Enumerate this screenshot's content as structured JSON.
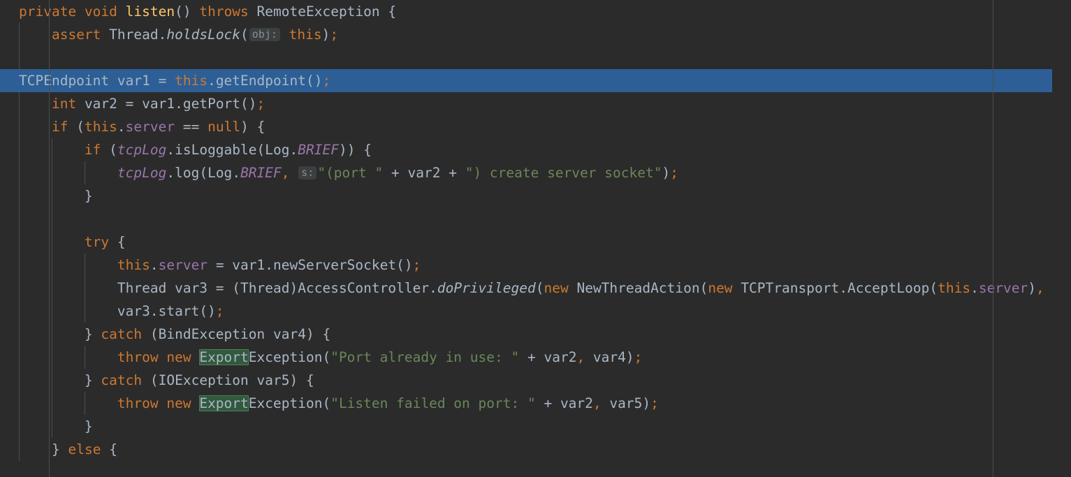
{
  "editor": {
    "app": "IntelliJ IDEA",
    "language": "Java",
    "theme": "Darcula",
    "caret_line_number": 5,
    "colors": {
      "background": "#2b2b2b",
      "caret_line": "#2d5f96",
      "keyword": "#cc7832",
      "identifier": "#a9b7c6",
      "method": "#ffc66d",
      "field": "#9876aa",
      "string": "#6a8759",
      "number": "#6897bb",
      "search_highlight": "#32593d",
      "guide_line": "#4b4e50",
      "hint_chip_bg": "#3b3f41",
      "hint_chip_text": "#8c8c8c"
    },
    "search_term": "Export"
  },
  "lines": [
    {
      "n": 1,
      "indent": 0,
      "tokens": [
        {
          "t": "private",
          "c": "kw"
        },
        {
          "t": " ",
          "c": "punc"
        },
        {
          "t": "void",
          "c": "kw"
        },
        {
          "t": " ",
          "c": "punc"
        },
        {
          "t": "listen",
          "c": "method"
        },
        {
          "t": "()",
          "c": "paren"
        },
        {
          "t": " ",
          "c": "punc"
        },
        {
          "t": "throws",
          "c": "kw"
        },
        {
          "t": " ",
          "c": "punc"
        },
        {
          "t": "RemoteException",
          "c": "type"
        },
        {
          "t": " ",
          "c": "punc"
        },
        {
          "t": "{",
          "c": "brace"
        }
      ]
    },
    {
      "n": 2,
      "indent": 1,
      "tokens": [
        {
          "t": "assert",
          "c": "kw"
        },
        {
          "t": " ",
          "c": "punc"
        },
        {
          "t": "Thread",
          "c": "type"
        },
        {
          "t": ".",
          "c": "punc"
        },
        {
          "t": "holdsLock",
          "c": "smethod"
        },
        {
          "t": "(",
          "c": "paren"
        },
        {
          "t": "obj:",
          "c": "hint"
        },
        {
          "t": " ",
          "c": "punc"
        },
        {
          "t": "this",
          "c": "kw"
        },
        {
          "t": ")",
          "c": "paren"
        },
        {
          "t": ";",
          "c": "semi"
        }
      ]
    },
    {
      "n": 3,
      "indent": 1,
      "tokens": []
    },
    {
      "n": 4,
      "indent": 1,
      "caret": true,
      "tokens": [
        {
          "t": "TCPEndpoint",
          "c": "type"
        },
        {
          "t": " var1 ",
          "c": "ident"
        },
        {
          "t": "=",
          "c": "punc"
        },
        {
          "t": " ",
          "c": "punc"
        },
        {
          "t": "this",
          "c": "kw"
        },
        {
          "t": ".",
          "c": "punc"
        },
        {
          "t": "getEndpoint",
          "c": "ident"
        },
        {
          "t": "()",
          "c": "paren"
        },
        {
          "t": ";",
          "c": "semi"
        }
      ]
    },
    {
      "n": 5,
      "indent": 1,
      "tokens": [
        {
          "t": "int",
          "c": "kw"
        },
        {
          "t": " var2 ",
          "c": "ident"
        },
        {
          "t": "=",
          "c": "punc"
        },
        {
          "t": " var1",
          "c": "ident"
        },
        {
          "t": ".",
          "c": "punc"
        },
        {
          "t": "getPort",
          "c": "ident"
        },
        {
          "t": "()",
          "c": "paren"
        },
        {
          "t": ";",
          "c": "semi"
        }
      ]
    },
    {
      "n": 6,
      "indent": 1,
      "tokens": [
        {
          "t": "if",
          "c": "kw"
        },
        {
          "t": " ",
          "c": "punc"
        },
        {
          "t": "(",
          "c": "paren"
        },
        {
          "t": "this",
          "c": "kw"
        },
        {
          "t": ".",
          "c": "punc"
        },
        {
          "t": "server",
          "c": "field"
        },
        {
          "t": " ",
          "c": "punc"
        },
        {
          "t": "==",
          "c": "punc"
        },
        {
          "t": " ",
          "c": "punc"
        },
        {
          "t": "null",
          "c": "kw"
        },
        {
          "t": ")",
          "c": "paren"
        },
        {
          "t": " ",
          "c": "punc"
        },
        {
          "t": "{",
          "c": "brace"
        }
      ]
    },
    {
      "n": 7,
      "indent": 2,
      "tokens": [
        {
          "t": "if",
          "c": "kw"
        },
        {
          "t": " ",
          "c": "punc"
        },
        {
          "t": "(",
          "c": "paren"
        },
        {
          "t": "tcpLog",
          "c": "sfield"
        },
        {
          "t": ".",
          "c": "punc"
        },
        {
          "t": "isLoggable",
          "c": "ident"
        },
        {
          "t": "(",
          "c": "paren"
        },
        {
          "t": "Log",
          "c": "type"
        },
        {
          "t": ".",
          "c": "punc"
        },
        {
          "t": "BRIEF",
          "c": "sfield"
        },
        {
          "t": "))",
          "c": "paren"
        },
        {
          "t": " ",
          "c": "punc"
        },
        {
          "t": "{",
          "c": "brace"
        }
      ]
    },
    {
      "n": 8,
      "indent": 3,
      "tokens": [
        {
          "t": "tcpLog",
          "c": "sfield"
        },
        {
          "t": ".",
          "c": "punc"
        },
        {
          "t": "log",
          "c": "ident"
        },
        {
          "t": "(",
          "c": "paren"
        },
        {
          "t": "Log",
          "c": "type"
        },
        {
          "t": ".",
          "c": "punc"
        },
        {
          "t": "BRIEF",
          "c": "sfield"
        },
        {
          "t": ",",
          "c": "semi"
        },
        {
          "t": " ",
          "c": "punc"
        },
        {
          "t": "s:",
          "c": "hint"
        },
        {
          "t": "\"(port \"",
          "c": "str"
        },
        {
          "t": " ",
          "c": "punc"
        },
        {
          "t": "+",
          "c": "punc"
        },
        {
          "t": " var2 ",
          "c": "ident"
        },
        {
          "t": "+",
          "c": "punc"
        },
        {
          "t": " ",
          "c": "punc"
        },
        {
          "t": "\") create server socket\"",
          "c": "str"
        },
        {
          "t": ")",
          "c": "paren"
        },
        {
          "t": ";",
          "c": "semi"
        }
      ]
    },
    {
      "n": 9,
      "indent": 2,
      "tokens": [
        {
          "t": "}",
          "c": "brace"
        }
      ]
    },
    {
      "n": 10,
      "indent": 2,
      "tokens": []
    },
    {
      "n": 11,
      "indent": 2,
      "tokens": [
        {
          "t": "try",
          "c": "kw"
        },
        {
          "t": " ",
          "c": "punc"
        },
        {
          "t": "{",
          "c": "brace"
        }
      ]
    },
    {
      "n": 12,
      "indent": 3,
      "tokens": [
        {
          "t": "this",
          "c": "kw"
        },
        {
          "t": ".",
          "c": "punc"
        },
        {
          "t": "server",
          "c": "field"
        },
        {
          "t": " ",
          "c": "punc"
        },
        {
          "t": "=",
          "c": "punc"
        },
        {
          "t": " var1",
          "c": "ident"
        },
        {
          "t": ".",
          "c": "punc"
        },
        {
          "t": "newServerSocket",
          "c": "ident"
        },
        {
          "t": "()",
          "c": "paren"
        },
        {
          "t": ";",
          "c": "semi"
        }
      ]
    },
    {
      "n": 13,
      "indent": 3,
      "tokens": [
        {
          "t": "Thread",
          "c": "type"
        },
        {
          "t": " var3 ",
          "c": "ident"
        },
        {
          "t": "=",
          "c": "punc"
        },
        {
          "t": " ",
          "c": "punc"
        },
        {
          "t": "(",
          "c": "paren"
        },
        {
          "t": "Thread",
          "c": "type"
        },
        {
          "t": ")",
          "c": "paren"
        },
        {
          "t": "AccessController",
          "c": "type"
        },
        {
          "t": ".",
          "c": "punc"
        },
        {
          "t": "doPrivileged",
          "c": "smethod"
        },
        {
          "t": "(",
          "c": "paren"
        },
        {
          "t": "new",
          "c": "kw"
        },
        {
          "t": " ",
          "c": "punc"
        },
        {
          "t": "NewThreadAction",
          "c": "type"
        },
        {
          "t": "(",
          "c": "paren"
        },
        {
          "t": "new",
          "c": "kw"
        },
        {
          "t": " ",
          "c": "punc"
        },
        {
          "t": "TCPTransport",
          "c": "type"
        },
        {
          "t": ".",
          "c": "punc"
        },
        {
          "t": "AcceptLoop",
          "c": "type"
        },
        {
          "t": "(",
          "c": "paren"
        },
        {
          "t": "this",
          "c": "kw"
        },
        {
          "t": ".",
          "c": "punc"
        },
        {
          "t": "server",
          "c": "field"
        },
        {
          "t": ")",
          "c": "paren"
        },
        {
          "t": ",",
          "c": "semi"
        }
      ]
    },
    {
      "n": 14,
      "indent": 3,
      "tokens": [
        {
          "t": "var3",
          "c": "ident"
        },
        {
          "t": ".",
          "c": "punc"
        },
        {
          "t": "start",
          "c": "ident"
        },
        {
          "t": "()",
          "c": "paren"
        },
        {
          "t": ";",
          "c": "semi"
        }
      ]
    },
    {
      "n": 15,
      "indent": 2,
      "tokens": [
        {
          "t": "}",
          "c": "brace"
        },
        {
          "t": " ",
          "c": "punc"
        },
        {
          "t": "catch",
          "c": "kw"
        },
        {
          "t": " ",
          "c": "punc"
        },
        {
          "t": "(",
          "c": "paren"
        },
        {
          "t": "BindException",
          "c": "type"
        },
        {
          "t": " var4",
          "c": "ident"
        },
        {
          "t": ")",
          "c": "paren"
        },
        {
          "t": " ",
          "c": "punc"
        },
        {
          "t": "{",
          "c": "brace"
        }
      ]
    },
    {
      "n": 16,
      "indent": 3,
      "tokens": [
        {
          "t": "throw",
          "c": "kw"
        },
        {
          "t": " ",
          "c": "punc"
        },
        {
          "t": "new",
          "c": "kw"
        },
        {
          "t": " ",
          "c": "punc"
        },
        {
          "t": "Export",
          "c": "searchhit"
        },
        {
          "t": "Exception",
          "c": "type"
        },
        {
          "t": "(",
          "c": "paren"
        },
        {
          "t": "\"Port already in use: \"",
          "c": "str"
        },
        {
          "t": " ",
          "c": "punc"
        },
        {
          "t": "+",
          "c": "punc"
        },
        {
          "t": " var2",
          "c": "ident"
        },
        {
          "t": ",",
          "c": "semi"
        },
        {
          "t": " var4",
          "c": "ident"
        },
        {
          "t": ")",
          "c": "paren"
        },
        {
          "t": ";",
          "c": "semi"
        }
      ]
    },
    {
      "n": 17,
      "indent": 2,
      "tokens": [
        {
          "t": "}",
          "c": "brace"
        },
        {
          "t": " ",
          "c": "punc"
        },
        {
          "t": "catch",
          "c": "kw"
        },
        {
          "t": " ",
          "c": "punc"
        },
        {
          "t": "(",
          "c": "paren"
        },
        {
          "t": "IOException",
          "c": "type"
        },
        {
          "t": " var5",
          "c": "ident"
        },
        {
          "t": ")",
          "c": "paren"
        },
        {
          "t": " ",
          "c": "punc"
        },
        {
          "t": "{",
          "c": "brace"
        }
      ]
    },
    {
      "n": 18,
      "indent": 3,
      "tokens": [
        {
          "t": "throw",
          "c": "kw"
        },
        {
          "t": " ",
          "c": "punc"
        },
        {
          "t": "new",
          "c": "kw"
        },
        {
          "t": " ",
          "c": "punc"
        },
        {
          "t": "Export",
          "c": "searchhit"
        },
        {
          "t": "Exception",
          "c": "type"
        },
        {
          "t": "(",
          "c": "paren"
        },
        {
          "t": "\"Listen failed on port: \"",
          "c": "str"
        },
        {
          "t": " ",
          "c": "punc"
        },
        {
          "t": "+",
          "c": "punc"
        },
        {
          "t": " var2",
          "c": "ident"
        },
        {
          "t": ",",
          "c": "semi"
        },
        {
          "t": " var5",
          "c": "ident"
        },
        {
          "t": ")",
          "c": "paren"
        },
        {
          "t": ";",
          "c": "semi"
        }
      ]
    },
    {
      "n": 19,
      "indent": 2,
      "tokens": [
        {
          "t": "}",
          "c": "brace"
        }
      ]
    },
    {
      "n": 20,
      "indent": 1,
      "tokens": [
        {
          "t": "}",
          "c": "brace"
        },
        {
          "t": " ",
          "c": "punc"
        },
        {
          "t": "else",
          "c": "kw"
        },
        {
          "t": " ",
          "c": "punc"
        },
        {
          "t": "{",
          "c": "brace"
        }
      ]
    }
  ]
}
